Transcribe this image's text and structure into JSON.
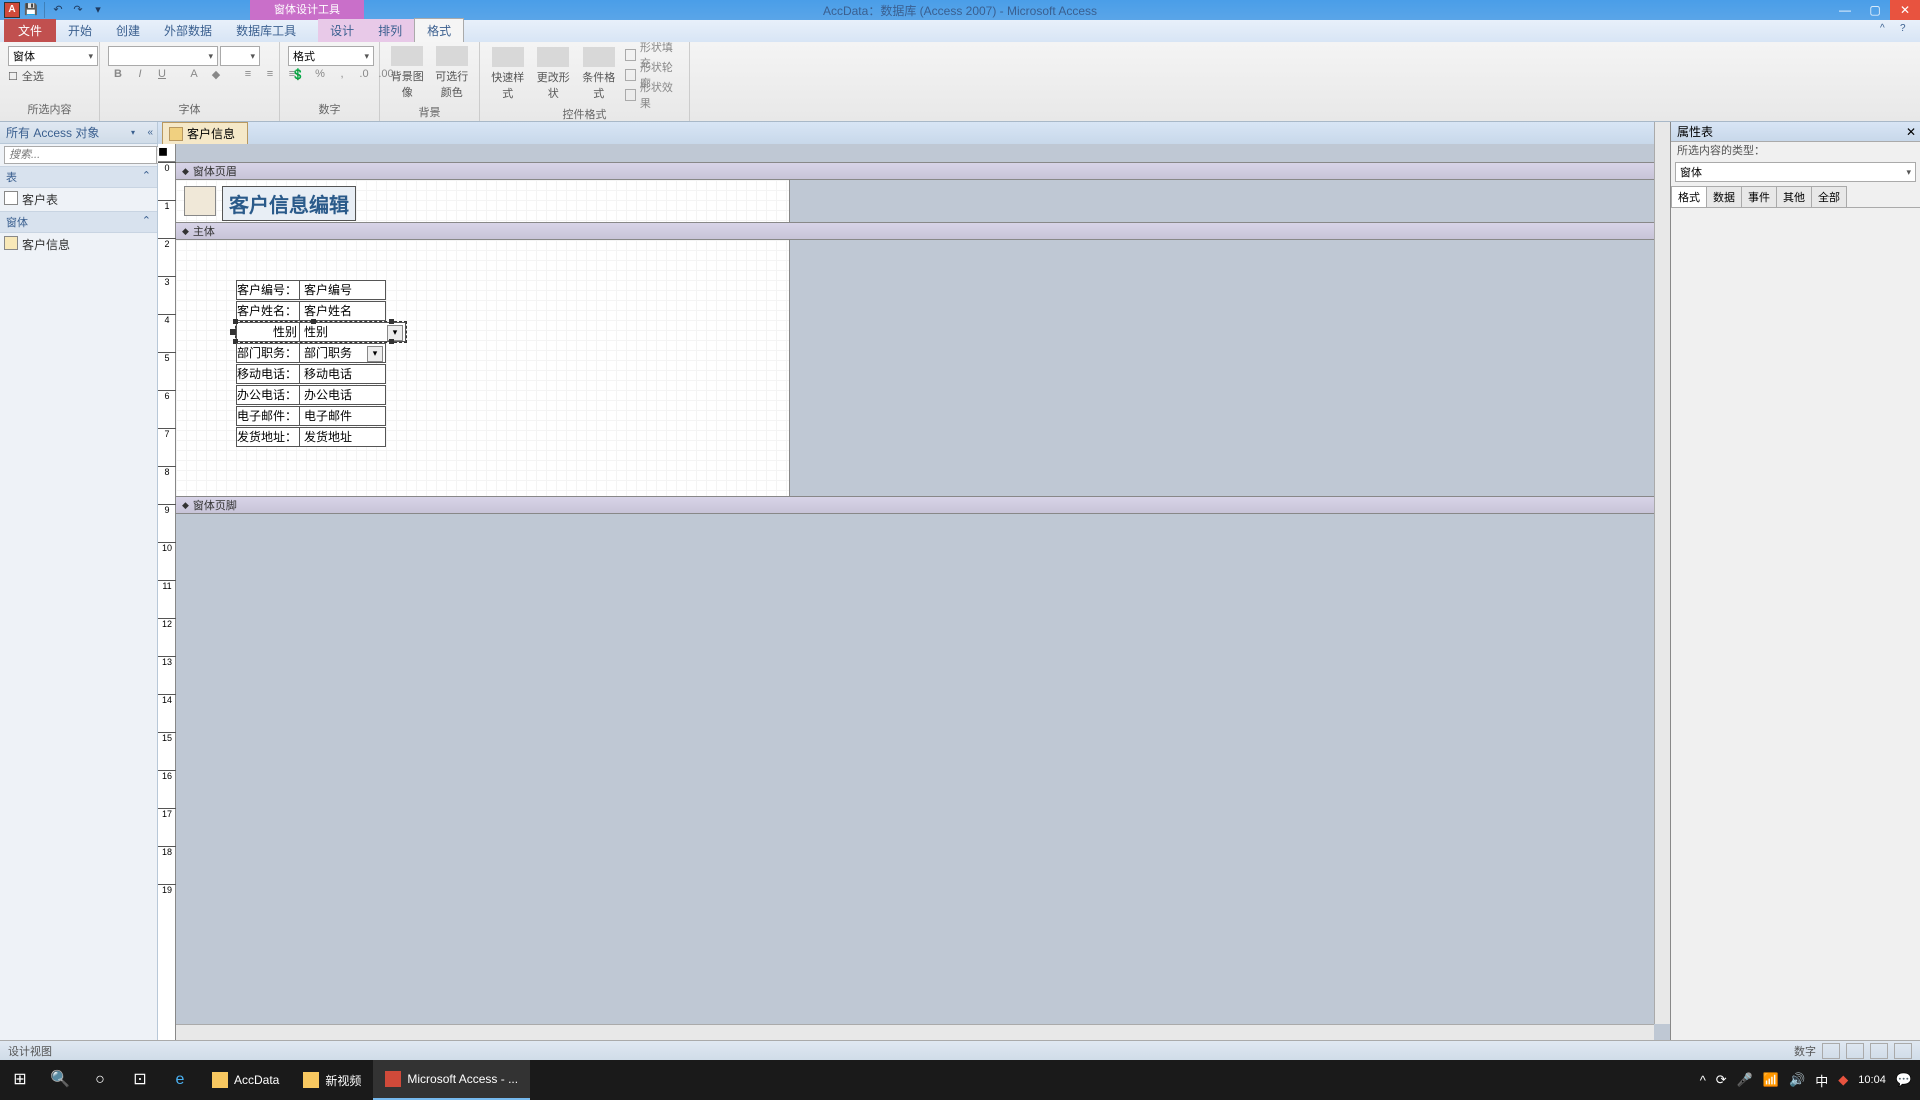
{
  "app": {
    "title": "AccData：数据库 (Access 2007) - Microsoft Access",
    "contextual_group": "窗体设计工具"
  },
  "qat": {
    "save": "💾",
    "undo": "↶",
    "redo": "↷"
  },
  "tabs": {
    "file": "文件",
    "home": "开始",
    "create": "创建",
    "external": "外部数据",
    "dbtools": "数据库工具",
    "design": "设计",
    "arrange": "排列",
    "format": "格式"
  },
  "ribbon": {
    "selection_group": "所选内容",
    "sel_type": "窗体",
    "sel_all": "全选",
    "font_group": "字体",
    "number_group": "数字",
    "format_label": "格式",
    "bg_group": "背景",
    "bg_image": "背景图像",
    "alt_color": "可选行颜色",
    "ctrl_group": "控件格式",
    "quick_style": "快速样式",
    "change_shape": "更改形状",
    "cond_format": "条件格式",
    "shape_fill": "形状填充",
    "shape_outline": "形状轮廓",
    "shape_effects": "形状效果"
  },
  "nav": {
    "header": "所有 Access 对象",
    "search_placeholder": "搜索...",
    "group_tables": "表",
    "group_forms": "窗体",
    "tbl_customer": "客户表",
    "frm_customer": "客户信息"
  },
  "doc": {
    "tab": "客户信息"
  },
  "sections": {
    "header": "窗体页眉",
    "detail": "主体",
    "footer": "窗体页脚"
  },
  "form": {
    "title": "客户信息编辑",
    "fields": [
      {
        "label": "客户编号：",
        "value": "客户编号",
        "type": "text"
      },
      {
        "label": "客户姓名：",
        "value": "客户姓名",
        "type": "text"
      },
      {
        "label": "性别",
        "value": "性别",
        "type": "combo",
        "selected": true
      },
      {
        "label": "部门职务：",
        "value": "部门职务",
        "type": "combo"
      },
      {
        "label": "移动电话：",
        "value": "移动电话",
        "type": "text"
      },
      {
        "label": "办公电话：",
        "value": "办公电话",
        "type": "text"
      },
      {
        "label": "电子邮件：",
        "value": "电子邮件",
        "type": "text"
      },
      {
        "label": "发货地址：",
        "value": "发货地址",
        "type": "text"
      }
    ]
  },
  "prop": {
    "title": "属性表",
    "subtitle": "所选内容的类型：",
    "obj": "窗体",
    "tabs": {
      "format": "格式",
      "data": "数据",
      "event": "事件",
      "other": "其他",
      "all": "全部"
    }
  },
  "status": {
    "left": "设计视图",
    "numlock": "数字"
  },
  "taskbar": {
    "items": [
      {
        "label": "AccData",
        "color": "#f8c860"
      },
      {
        "label": "新视频",
        "color": "#f8c860"
      },
      {
        "label": "Microsoft Access - ...",
        "color": "#d04a3a",
        "active": true
      }
    ],
    "time": "10:04"
  }
}
